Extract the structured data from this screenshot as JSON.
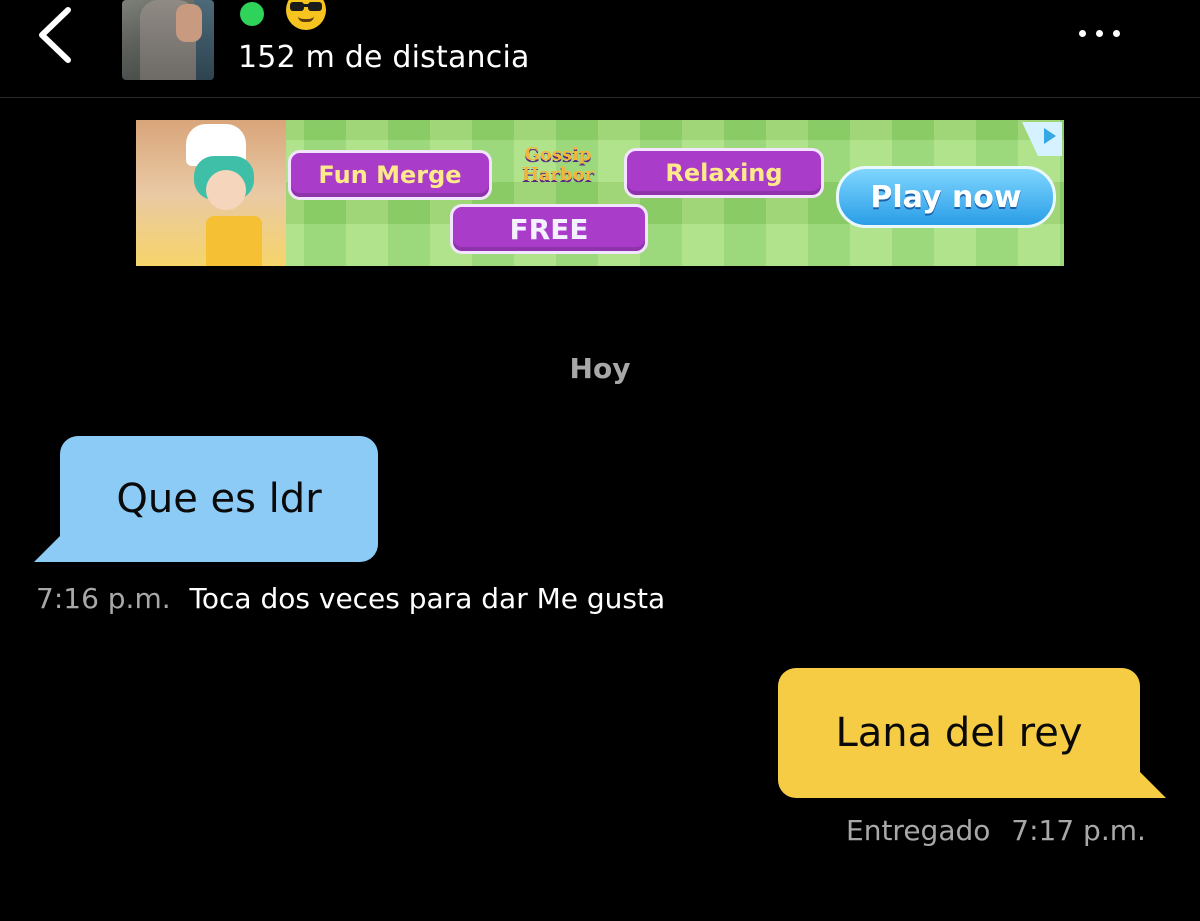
{
  "header": {
    "back_icon": "chevron-left-icon",
    "status_emoji_icon": "sunglasses-face-icon",
    "distance": "152 m de distancia",
    "more_icon": "more-horizontal-icon",
    "online_color": "#2fd35a"
  },
  "ad": {
    "tag_1": "Fun Merge",
    "tag_2": "Relaxing",
    "tag_3": "FREE",
    "logo_line_1": "Gossip",
    "logo_line_2": "Harbor",
    "cta": "Play now",
    "choices_icon": "ad-choices-icon"
  },
  "chat": {
    "date_label": "Hoy",
    "messages": [
      {
        "direction": "incoming",
        "text": "Que es ldr",
        "time": "7:16 p.m.",
        "hint": "Toca dos veces para dar Me gusta",
        "bubble_color": "#8bcbf6"
      },
      {
        "direction": "outgoing",
        "text": "Lana del rey",
        "status": "Entregado",
        "time": "7:17 p.m.",
        "bubble_color": "#f6cc45"
      }
    ]
  }
}
